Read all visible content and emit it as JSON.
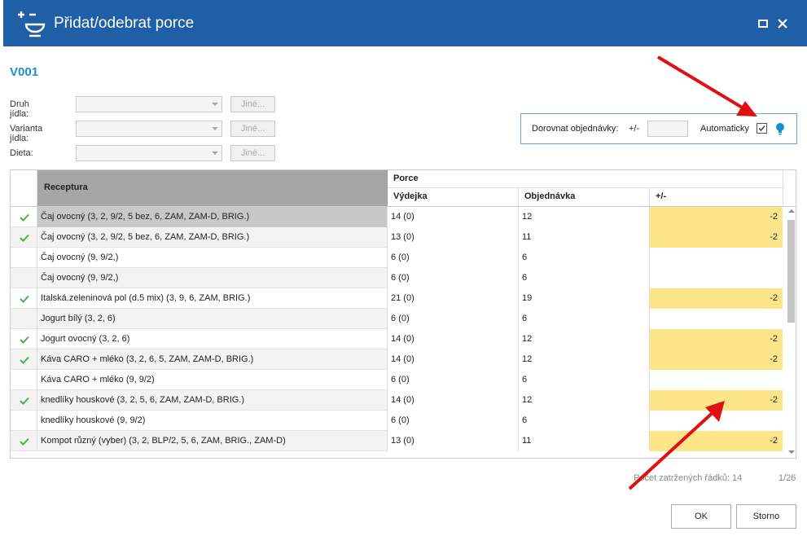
{
  "window": {
    "title": "Přidat/odebrat porce"
  },
  "code": "V001",
  "filters": [
    {
      "label": "Druh jídla:",
      "value": "",
      "button": "Jiné..."
    },
    {
      "label": "Varianta jídla:",
      "value": "",
      "button": "Jiné..."
    },
    {
      "label": "Dieta:",
      "value": "",
      "button": "Jiné..."
    }
  ],
  "dorovnat": {
    "label": "Dorovnat objednávky:",
    "pm": "+/-",
    "value": "",
    "auto_label": "Automaticky",
    "auto_checked": true
  },
  "grid": {
    "header_receptura": "Receptura",
    "header_porce": "Porce",
    "header_vydejka": "Výdejka",
    "header_objednavka": "Objednávka",
    "header_pm": "+/-",
    "rows": [
      {
        "check": true,
        "name": "Čaj ovocný (3, 2, 9/2, 5 bez, 6, ZAM, ZAM-D, BRIG.)",
        "vydejka": "14 (0)",
        "objednavka": "12",
        "pm": "-2"
      },
      {
        "check": true,
        "name": "Čaj ovocný (3, 2, 9/2, 5 bez, 6, ZAM, ZAM-D, BRIG.)",
        "vydejka": "13 (0)",
        "objednavka": "11",
        "pm": "-2"
      },
      {
        "check": false,
        "name": "Čaj ovocný (9, 9/2,)",
        "vydejka": "6 (0)",
        "objednavka": "6",
        "pm": ""
      },
      {
        "check": false,
        "name": "Čaj ovocný (9, 9/2,)",
        "vydejka": "6 (0)",
        "objednavka": "6",
        "pm": ""
      },
      {
        "check": true,
        "name": "Italská.zeleninová pol (d.5 mix) (3, 9, 6, ZAM, BRIG.)",
        "vydejka": "21 (0)",
        "objednavka": "19",
        "pm": "-2"
      },
      {
        "check": false,
        "name": "Jogurt bílý (3, 2, 6)",
        "vydejka": "6 (0)",
        "objednavka": "6",
        "pm": ""
      },
      {
        "check": true,
        "name": "Jogurt ovocný (3, 2, 6)",
        "vydejka": "14 (0)",
        "objednavka": "12",
        "pm": "-2"
      },
      {
        "check": true,
        "name": "Káva CARO + mléko (3, 2, 6, 5, ZAM, ZAM-D, BRIG.)",
        "vydejka": "14 (0)",
        "objednavka": "12",
        "pm": "-2"
      },
      {
        "check": false,
        "name": "Káva CARO + mléko (9, 9/2)",
        "vydejka": "6 (0)",
        "objednavka": "6",
        "pm": ""
      },
      {
        "check": true,
        "name": "knedlíky houskové (3, 2, 5, 6, ZAM, ZAM-D, BRIG.)",
        "vydejka": "14 (0)",
        "objednavka": "12",
        "pm": "-2"
      },
      {
        "check": false,
        "name": "knedlíky houskové (9, 9/2)",
        "vydejka": "6 (0)",
        "objednavka": "6",
        "pm": ""
      },
      {
        "check": true,
        "name": "Kompot různý (vyber) (3, 2, BLP/2, 5, 6, ZAM, BRIG., ZAM-D)",
        "vydejka": "13 (0)",
        "objednavka": "11",
        "pm": "-2"
      }
    ]
  },
  "footer": {
    "count_label": "Počet zatržených řádků: 14",
    "page": "1/26"
  },
  "buttons": {
    "ok": "OK",
    "storno": "Storno"
  },
  "colors": {
    "titlebar": "#1e5fa8",
    "accent": "#1a8fd6",
    "highlight": "#fde68a",
    "check": "#4caf50",
    "annotation": "#e01010"
  }
}
